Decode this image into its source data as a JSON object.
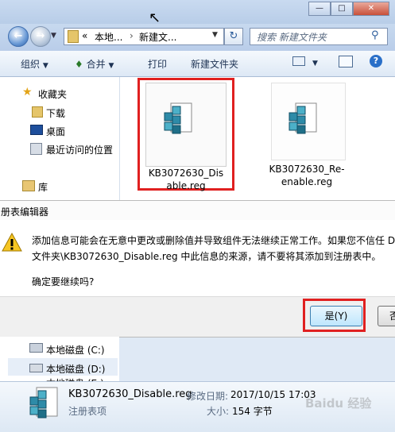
{
  "explorer": {
    "address_prefix": "«",
    "address_seg1": "本地...",
    "address_sep": "›",
    "address_seg2": "新建文...",
    "search_placeholder": "搜索 新建文件夹",
    "toolbar": {
      "organize": "组织",
      "open_with": "合并",
      "print": "打印",
      "new_folder": "新建文件夹"
    },
    "nav": {
      "favorites": "收藏夹",
      "downloads": "下载",
      "desktop": "桌面",
      "recent": "最近访问的位置",
      "libraries": "库",
      "drive_c": "本地磁盘 (C:)",
      "drive_d": "本地磁盘 (D:)",
      "drive_e_partial": "本地磁盘 (E:)"
    },
    "files": [
      {
        "name_line1": "KB3072630_Dis",
        "name_line2": "able.reg"
      },
      {
        "name_line1": "KB3072630_Re-",
        "name_line2": "enable.reg"
      }
    ],
    "details": {
      "filename": "KB3072630_Disable.reg",
      "type": "注册表项",
      "modified_label": "修改日期:",
      "modified_value": "2017/10/15 17:03",
      "size_label": "大小:",
      "size_value": "154 字节"
    }
  },
  "dialog": {
    "title": "册表编辑器",
    "message_line1": "添加信息可能会在无意中更改或删除值并导致组件无法继续正常工作。如果您不信任 D",
    "message_line2": "文件夹\\KB3072630_Disable.reg 中此信息的来源，请不要将其添加到注册表中。",
    "question": "确定要继续吗?",
    "yes_label": "是(Y)",
    "no_label_partial": "否"
  },
  "watermark": "Baidu 经验",
  "colors": {
    "highlight_red": "#e02020",
    "accent_blue": "#3c7fb1"
  }
}
